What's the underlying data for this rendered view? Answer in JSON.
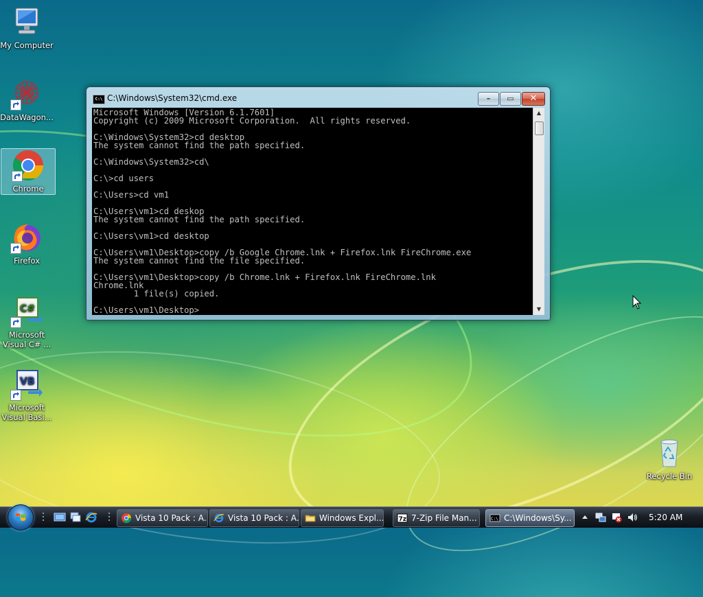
{
  "desktop": {
    "icons": [
      {
        "label": "My Computer",
        "icon": "computer-icon"
      },
      {
        "label": "DataWagon...",
        "icon": "datawagon-icon"
      },
      {
        "label": "Chrome",
        "icon": "chrome-icon"
      },
      {
        "label": "Firefox",
        "icon": "firefox-icon"
      },
      {
        "label": "Microsoft Visual C# ...",
        "icon": "visual-csharp-icon"
      },
      {
        "label": "Microsoft Visual Basi...",
        "icon": "visual-basic-icon"
      },
      {
        "label": "Recycle Bin",
        "icon": "recycle-bin-icon"
      }
    ]
  },
  "cmd_window": {
    "title": "C:\\Windows\\System32\\cmd.exe",
    "console_lines": [
      "Microsoft Windows [Version 6.1.7601]",
      "Copyright (c) 2009 Microsoft Corporation.  All rights reserved.",
      "",
      "C:\\Windows\\System32>cd desktop",
      "The system cannot find the path specified.",
      "",
      "C:\\Windows\\System32>cd\\",
      "",
      "C:\\>cd users",
      "",
      "C:\\Users>cd vm1",
      "",
      "C:\\Users\\vm1>cd deskop",
      "The system cannot find the path specified.",
      "",
      "C:\\Users\\vm1>cd desktop",
      "",
      "C:\\Users\\vm1\\Desktop>copy /b Google Chrome.lnk + Firefox.lnk FireChrome.exe",
      "The system cannot find the file specified.",
      "",
      "C:\\Users\\vm1\\Desktop>copy /b Chrome.lnk + Firefox.lnk FireChrome.lnk",
      "Chrome.lnk",
      "        1 file(s) copied.",
      "",
      "C:\\Users\\vm1\\Desktop>"
    ]
  },
  "taskbar": {
    "buttons": [
      {
        "label": "Vista 10 Pack : A...",
        "icon": "chrome-icon"
      },
      {
        "label": "Vista 10 Pack : A...",
        "icon": "internet-explorer-icon"
      },
      {
        "label": "Windows Expl...",
        "icon": "folder-icon"
      },
      {
        "label": "7-Zip File Man...",
        "icon": "seven-zip-icon"
      },
      {
        "label": "C:\\Windows\\Sy...",
        "icon": "cmd-icon"
      }
    ],
    "clock": "5:20 AM"
  }
}
